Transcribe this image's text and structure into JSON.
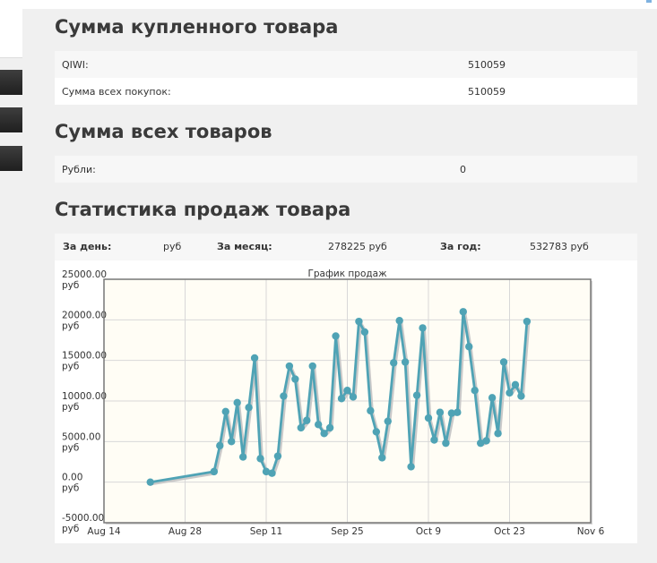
{
  "purchased": {
    "title": "Сумма купленного товара",
    "rows": [
      {
        "label": "QIWI:",
        "value": "510059"
      },
      {
        "label": "Сумма всех покупок:",
        "value": "510059"
      }
    ]
  },
  "all_goods": {
    "title": "Сумма всех товаров",
    "rows": [
      {
        "label": "Рубли:",
        "value": "0"
      }
    ]
  },
  "stats": {
    "title": "Статистика продаж товара",
    "day_label": "За день:",
    "day_value": "руб",
    "month_label": "За месяц:",
    "month_value": "278225 руб",
    "year_label": "За год:",
    "year_value": "532783 руб"
  },
  "chart_data": {
    "type": "line",
    "title": "График продаж",
    "y_ticks": [
      "25000.00 руб",
      "20000.00 руб",
      "15000.00 руб",
      "10000.00 руб",
      "5000.00 руб",
      "0.00 руб",
      "-5000.00 руб"
    ],
    "x_ticks": [
      "Aug 14",
      "Aug 28",
      "Sep 11",
      "Sep 25",
      "Oct 9",
      "Oct 23",
      "Nov 6"
    ],
    "ylim": [
      -5000,
      25000
    ],
    "xlim": [
      "2013-08-14",
      "2013-11-06"
    ],
    "grid": true,
    "colors": {
      "line": "#4fa3b5",
      "plot_bg": "#fffdf5",
      "grid": "#d8d8d8"
    },
    "x": [
      "2013-08-22",
      "2013-09-02",
      "2013-09-03",
      "2013-09-04",
      "2013-09-05",
      "2013-09-06",
      "2013-09-07",
      "2013-09-08",
      "2013-09-09",
      "2013-09-10",
      "2013-09-11",
      "2013-09-12",
      "2013-09-13",
      "2013-09-14",
      "2013-09-15",
      "2013-09-16",
      "2013-09-17",
      "2013-09-18",
      "2013-09-19",
      "2013-09-20",
      "2013-09-21",
      "2013-09-22",
      "2013-09-23",
      "2013-09-24",
      "2013-09-25",
      "2013-09-26",
      "2013-09-27",
      "2013-09-28",
      "2013-09-29",
      "2013-09-30",
      "2013-10-01",
      "2013-10-02",
      "2013-10-03",
      "2013-10-04",
      "2013-10-05",
      "2013-10-06",
      "2013-10-07",
      "2013-10-08",
      "2013-10-09",
      "2013-10-10",
      "2013-10-11",
      "2013-10-12",
      "2013-10-13",
      "2013-10-14",
      "2013-10-15",
      "2013-10-16",
      "2013-10-17",
      "2013-10-18",
      "2013-10-19",
      "2013-10-20",
      "2013-10-21",
      "2013-10-22",
      "2013-10-23",
      "2013-10-24",
      "2013-10-25",
      "2013-10-26"
    ],
    "values": [
      0,
      1300,
      4500,
      8700,
      5000,
      9800,
      3100,
      9200,
      15300,
      2900,
      1300,
      1100,
      3200,
      10600,
      14300,
      12700,
      6700,
      7600,
      14300,
      7100,
      6000,
      6700,
      18000,
      10300,
      11300,
      10500,
      19800,
      18500,
      8800,
      6200,
      3000,
      7500,
      14700,
      19900,
      14800,
      1900,
      10700,
      19000,
      7900,
      5200,
      8600,
      4800,
      8500,
      8600,
      21000,
      16700,
      11300,
      4800,
      5100,
      10400,
      6000,
      14800,
      11000,
      12000,
      10600,
      19800
    ]
  }
}
